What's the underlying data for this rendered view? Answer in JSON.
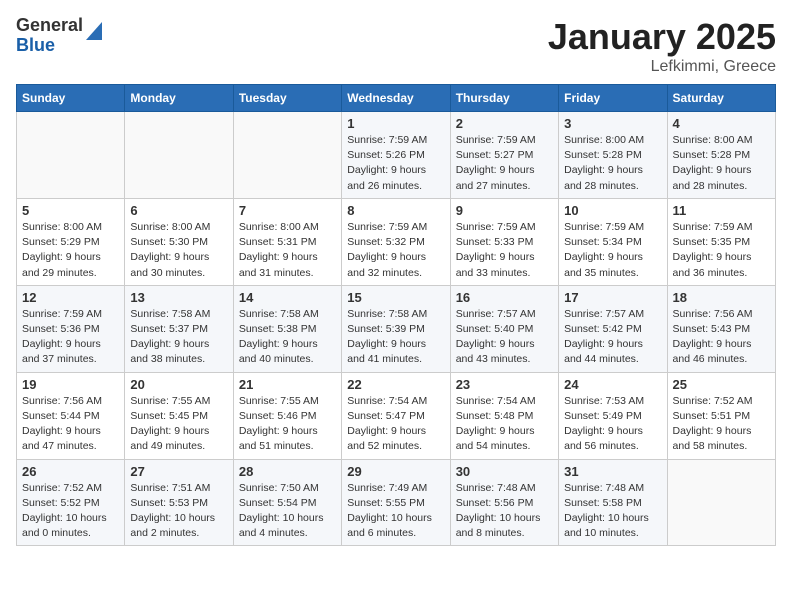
{
  "header": {
    "logo_general": "General",
    "logo_blue": "Blue",
    "month_title": "January 2025",
    "location": "Lefkimmi, Greece"
  },
  "days_of_week": [
    "Sunday",
    "Monday",
    "Tuesday",
    "Wednesday",
    "Thursday",
    "Friday",
    "Saturday"
  ],
  "weeks": [
    [
      {
        "day": "",
        "info": ""
      },
      {
        "day": "",
        "info": ""
      },
      {
        "day": "",
        "info": ""
      },
      {
        "day": "1",
        "info": "Sunrise: 7:59 AM\nSunset: 5:26 PM\nDaylight: 9 hours and 26 minutes."
      },
      {
        "day": "2",
        "info": "Sunrise: 7:59 AM\nSunset: 5:27 PM\nDaylight: 9 hours and 27 minutes."
      },
      {
        "day": "3",
        "info": "Sunrise: 8:00 AM\nSunset: 5:28 PM\nDaylight: 9 hours and 28 minutes."
      },
      {
        "day": "4",
        "info": "Sunrise: 8:00 AM\nSunset: 5:28 PM\nDaylight: 9 hours and 28 minutes."
      }
    ],
    [
      {
        "day": "5",
        "info": "Sunrise: 8:00 AM\nSunset: 5:29 PM\nDaylight: 9 hours and 29 minutes."
      },
      {
        "day": "6",
        "info": "Sunrise: 8:00 AM\nSunset: 5:30 PM\nDaylight: 9 hours and 30 minutes."
      },
      {
        "day": "7",
        "info": "Sunrise: 8:00 AM\nSunset: 5:31 PM\nDaylight: 9 hours and 31 minutes."
      },
      {
        "day": "8",
        "info": "Sunrise: 7:59 AM\nSunset: 5:32 PM\nDaylight: 9 hours and 32 minutes."
      },
      {
        "day": "9",
        "info": "Sunrise: 7:59 AM\nSunset: 5:33 PM\nDaylight: 9 hours and 33 minutes."
      },
      {
        "day": "10",
        "info": "Sunrise: 7:59 AM\nSunset: 5:34 PM\nDaylight: 9 hours and 35 minutes."
      },
      {
        "day": "11",
        "info": "Sunrise: 7:59 AM\nSunset: 5:35 PM\nDaylight: 9 hours and 36 minutes."
      }
    ],
    [
      {
        "day": "12",
        "info": "Sunrise: 7:59 AM\nSunset: 5:36 PM\nDaylight: 9 hours and 37 minutes."
      },
      {
        "day": "13",
        "info": "Sunrise: 7:58 AM\nSunset: 5:37 PM\nDaylight: 9 hours and 38 minutes."
      },
      {
        "day": "14",
        "info": "Sunrise: 7:58 AM\nSunset: 5:38 PM\nDaylight: 9 hours and 40 minutes."
      },
      {
        "day": "15",
        "info": "Sunrise: 7:58 AM\nSunset: 5:39 PM\nDaylight: 9 hours and 41 minutes."
      },
      {
        "day": "16",
        "info": "Sunrise: 7:57 AM\nSunset: 5:40 PM\nDaylight: 9 hours and 43 minutes."
      },
      {
        "day": "17",
        "info": "Sunrise: 7:57 AM\nSunset: 5:42 PM\nDaylight: 9 hours and 44 minutes."
      },
      {
        "day": "18",
        "info": "Sunrise: 7:56 AM\nSunset: 5:43 PM\nDaylight: 9 hours and 46 minutes."
      }
    ],
    [
      {
        "day": "19",
        "info": "Sunrise: 7:56 AM\nSunset: 5:44 PM\nDaylight: 9 hours and 47 minutes."
      },
      {
        "day": "20",
        "info": "Sunrise: 7:55 AM\nSunset: 5:45 PM\nDaylight: 9 hours and 49 minutes."
      },
      {
        "day": "21",
        "info": "Sunrise: 7:55 AM\nSunset: 5:46 PM\nDaylight: 9 hours and 51 minutes."
      },
      {
        "day": "22",
        "info": "Sunrise: 7:54 AM\nSunset: 5:47 PM\nDaylight: 9 hours and 52 minutes."
      },
      {
        "day": "23",
        "info": "Sunrise: 7:54 AM\nSunset: 5:48 PM\nDaylight: 9 hours and 54 minutes."
      },
      {
        "day": "24",
        "info": "Sunrise: 7:53 AM\nSunset: 5:49 PM\nDaylight: 9 hours and 56 minutes."
      },
      {
        "day": "25",
        "info": "Sunrise: 7:52 AM\nSunset: 5:51 PM\nDaylight: 9 hours and 58 minutes."
      }
    ],
    [
      {
        "day": "26",
        "info": "Sunrise: 7:52 AM\nSunset: 5:52 PM\nDaylight: 10 hours and 0 minutes."
      },
      {
        "day": "27",
        "info": "Sunrise: 7:51 AM\nSunset: 5:53 PM\nDaylight: 10 hours and 2 minutes."
      },
      {
        "day": "28",
        "info": "Sunrise: 7:50 AM\nSunset: 5:54 PM\nDaylight: 10 hours and 4 minutes."
      },
      {
        "day": "29",
        "info": "Sunrise: 7:49 AM\nSunset: 5:55 PM\nDaylight: 10 hours and 6 minutes."
      },
      {
        "day": "30",
        "info": "Sunrise: 7:48 AM\nSunset: 5:56 PM\nDaylight: 10 hours and 8 minutes."
      },
      {
        "day": "31",
        "info": "Sunrise: 7:48 AM\nSunset: 5:58 PM\nDaylight: 10 hours and 10 minutes."
      },
      {
        "day": "",
        "info": ""
      }
    ]
  ]
}
